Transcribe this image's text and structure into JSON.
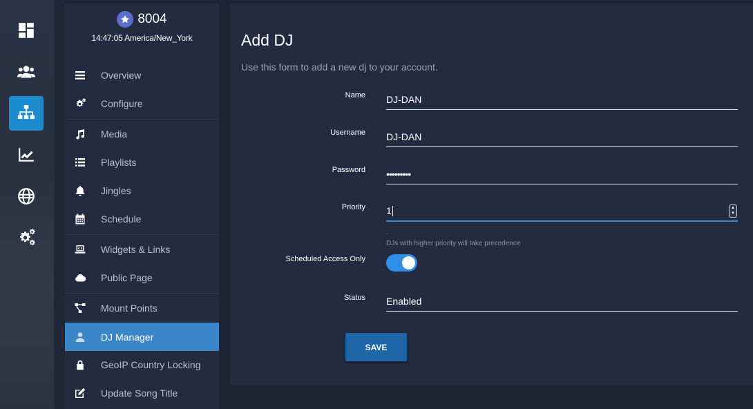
{
  "rail": {
    "items": [
      {
        "icon": "dashboard-icon",
        "active": false
      },
      {
        "icon": "users-icon",
        "active": false
      },
      {
        "icon": "sitemap-icon",
        "active": true
      },
      {
        "icon": "chart-line-icon",
        "active": false
      },
      {
        "icon": "globe-icon",
        "active": false
      },
      {
        "icon": "cogs-icon",
        "active": false
      }
    ]
  },
  "server": {
    "name": "8004",
    "time": "14:47:05 America/New_York"
  },
  "sidebar": {
    "items": [
      {
        "label": "Overview",
        "icon": "bars-icon"
      },
      {
        "label": "Configure",
        "icon": "cogs-icon"
      },
      {
        "label": "Media",
        "icon": "music-icon"
      },
      {
        "label": "Playlists",
        "icon": "list-icon"
      },
      {
        "label": "Jingles",
        "icon": "bell-icon"
      },
      {
        "label": "Schedule",
        "icon": "calendar-icon"
      },
      {
        "label": "Widgets & Links",
        "icon": "laptop-code-icon"
      },
      {
        "label": "Public Page",
        "icon": "cloud-icon"
      },
      {
        "label": "Mount Points",
        "icon": "project-diagram-icon"
      },
      {
        "label": "DJ Manager",
        "icon": "user-icon",
        "active": true
      },
      {
        "label": "GeoIP Country Locking",
        "icon": "lock-icon"
      },
      {
        "label": "Update Song Title",
        "icon": "edit-icon"
      }
    ]
  },
  "form": {
    "title": "Add DJ",
    "description": "Use this form to add a new dj to your account.",
    "name_label": "Name",
    "name_value": "DJ-DAN",
    "username_label": "Username",
    "username_value": "DJ-DAN",
    "password_label": "Password",
    "password_value": "•••••••••",
    "priority_label": "Priority",
    "priority_value": "1",
    "priority_hint_mark": ".",
    "priority_hint": "DJs with higher priority will take precedence",
    "scheduled_label": "Scheduled Access Only",
    "scheduled_on": true,
    "status_label": "Status",
    "status_value": "Enabled",
    "save_label": "SAVE"
  },
  "colors": {
    "accent": "#3a86c8",
    "rail_active": "#1d8ccf",
    "toggle_on": "#2f8fe6",
    "save_button": "#1e66a8",
    "panel": "#222b3f",
    "background": "#1b2335"
  }
}
